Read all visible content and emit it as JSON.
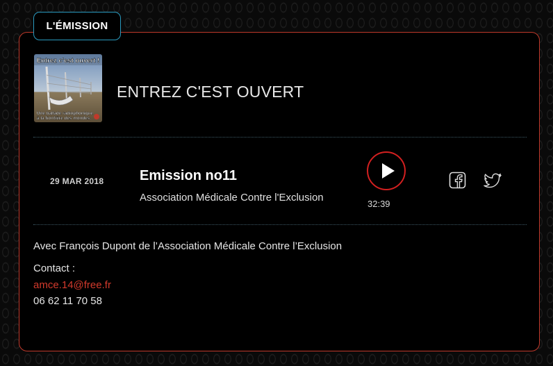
{
  "section_tab": {
    "label": "L'ÉMISSION"
  },
  "show": {
    "title": "ENTREZ C'EST OUVERT",
    "cover": {
      "top_text": "Entrez c'est ouvert !",
      "bottom_text_line1": "Une ballade radiophonique",
      "bottom_text_line2": "à la frontière des mondes."
    }
  },
  "episode": {
    "date": "29 MAR 2018",
    "title": "Emission no11",
    "subtitle": "Association Médicale Contre l'Exclusion",
    "duration": "32:39",
    "play_icon": "play-icon"
  },
  "share": {
    "facebook_icon": "facebook-icon",
    "twitter_icon": "twitter-icon"
  },
  "details": {
    "description": "Avec François Dupont de l’Association Médicale Contre l’Exclusion",
    "contact_label": "Contact :",
    "email": "amce.14@free.fr",
    "phone": "06 62 11 70 58"
  },
  "colors": {
    "accent_red": "#d32020",
    "tab_border": "#2a9bc0",
    "link_red": "#d33a2c"
  }
}
